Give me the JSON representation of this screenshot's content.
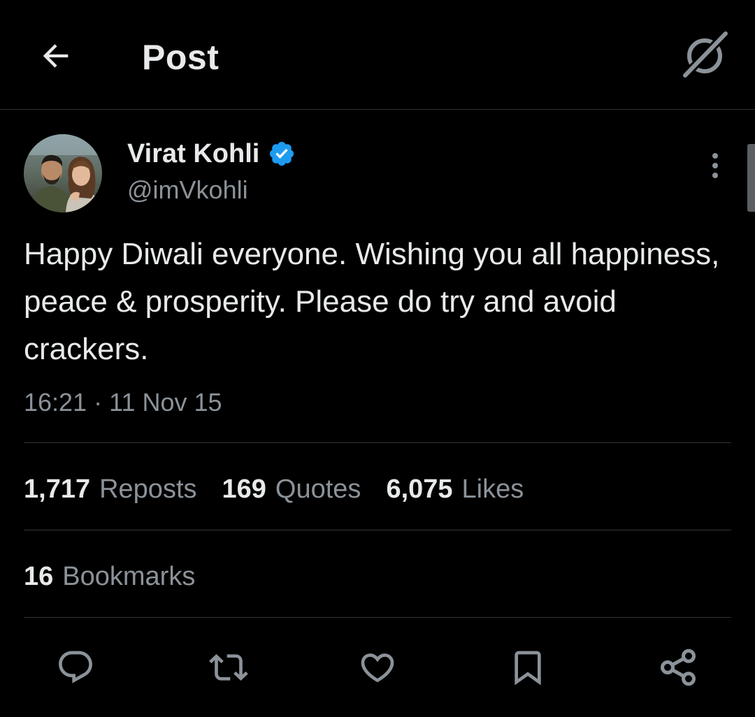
{
  "header": {
    "title": "Post",
    "back_icon": "arrow-left-icon",
    "grok_icon": "grok-icon"
  },
  "author": {
    "name": "Virat Kohli",
    "handle": "@imVkohli",
    "verified": true,
    "verified_color": "#1d9bf0"
  },
  "post": {
    "text": "Happy Diwali everyone. Wishing you all happiness, peace & prosperity. Please do try and avoid crackers.",
    "time": "16:21",
    "separator": "·",
    "date": "11 Nov 15"
  },
  "stats": {
    "reposts": {
      "count": "1,717",
      "label": "Reposts"
    },
    "quotes": {
      "count": "169",
      "label": "Quotes"
    },
    "likes": {
      "count": "6,075",
      "label": "Likes"
    },
    "bookmarks": {
      "count": "16",
      "label": "Bookmarks"
    }
  },
  "actions": [
    {
      "icon": "reply-icon"
    },
    {
      "icon": "repost-icon"
    },
    {
      "icon": "like-icon"
    },
    {
      "icon": "bookmark-icon"
    },
    {
      "icon": "share-icon"
    }
  ],
  "colors": {
    "background": "#000000",
    "text_primary": "#e7e9ea",
    "text_secondary": "#8b9299",
    "divider": "#2f3336",
    "icon": "#8b9299"
  }
}
